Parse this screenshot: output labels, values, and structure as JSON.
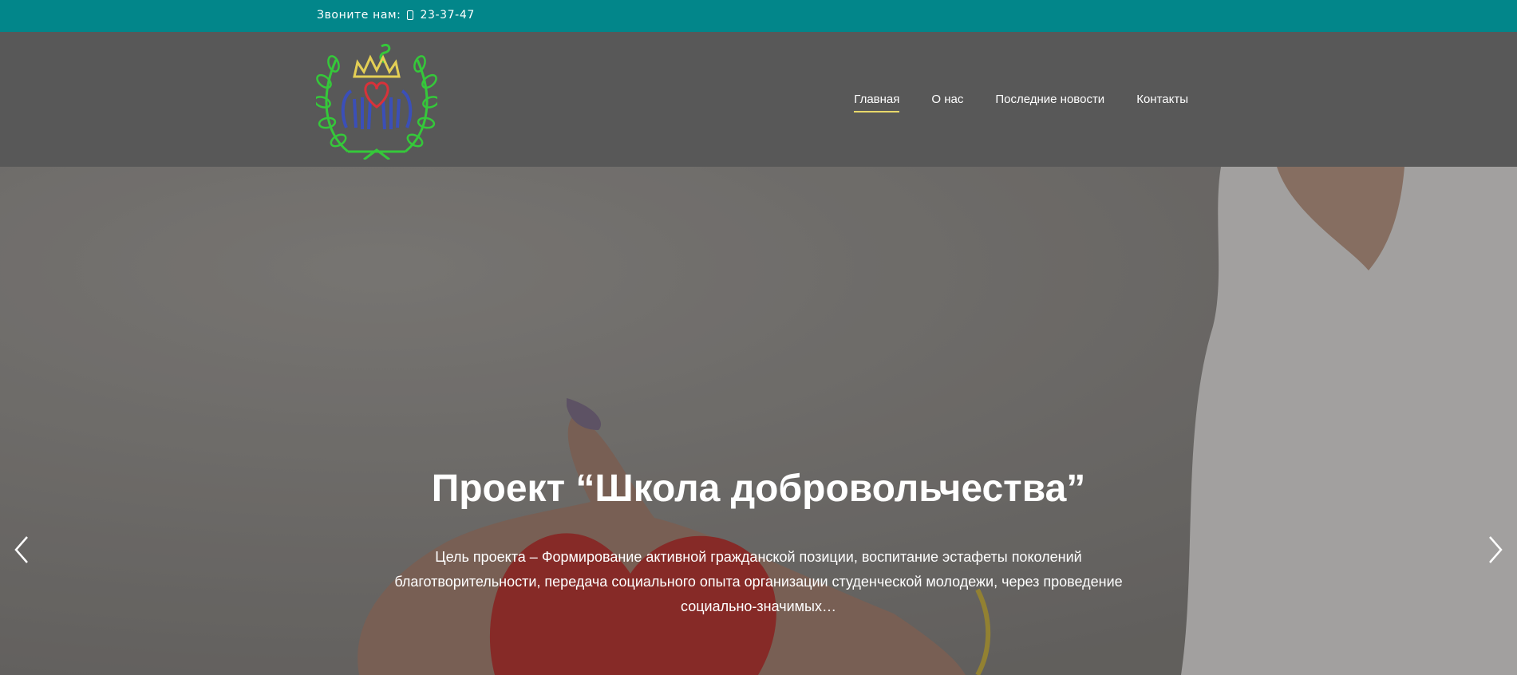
{
  "topbar": {
    "call_label": "Звоните нам:",
    "phone_icon": "phone-icon",
    "phone": "23-37-47",
    "background": "#02868a"
  },
  "header": {
    "background": "#585858",
    "logo_icon": "heart-hands-laurel-logo"
  },
  "nav": {
    "items": [
      {
        "label": "Главная",
        "active": true
      },
      {
        "label": "О нас",
        "active": false
      },
      {
        "label": "Последние новости",
        "active": false
      },
      {
        "label": "Контакты",
        "active": false
      }
    ],
    "active_underline_color": "#e8d86a"
  },
  "slider": {
    "title": "Проект “Школа добровольчества”",
    "text_line1": "Цель проекта – Формирование активной гражданской позиции, воспитание эстафеты поколений",
    "text_line2": "благотворительности, передача социального опыта организации  студенческой молодежи, через проведение",
    "text_line3": "социально-значимых…",
    "prev_icon": "chevron-left-icon",
    "next_icon": "chevron-right-icon"
  }
}
